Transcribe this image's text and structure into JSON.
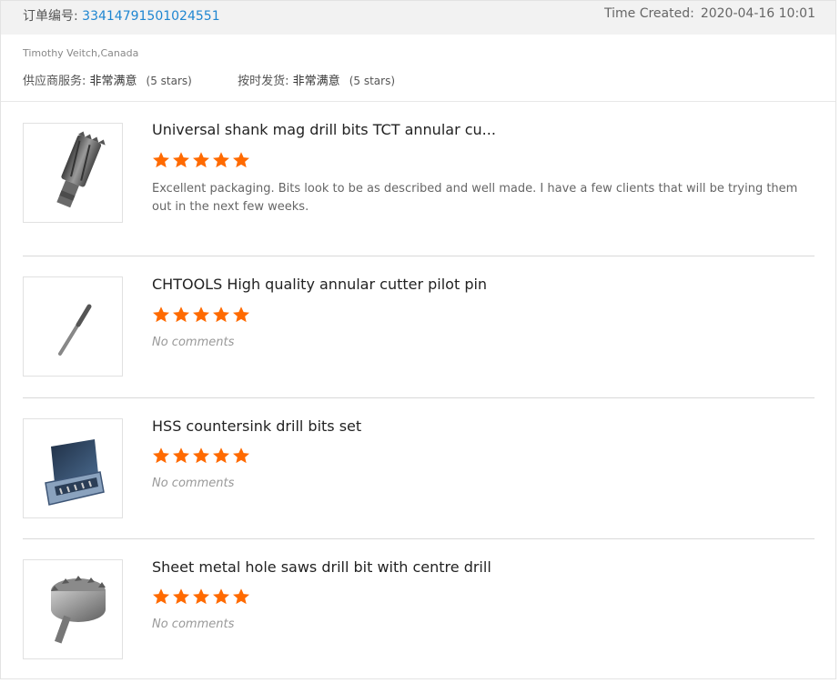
{
  "order": {
    "number_label": "订单编号:",
    "number": "33414791501024551",
    "time_label": "Time Created:",
    "time": "2020-04-16 10:01"
  },
  "buyer": {
    "name": "Timothy Veitch,Canada"
  },
  "seller_ratings": {
    "service_label": "供应商服务:",
    "service_value": "非常满意",
    "service_stars": "(5 stars)",
    "shipping_label": "按时发货:",
    "shipping_value": "非常满意",
    "shipping_stars": "(5 stars)"
  },
  "colors": {
    "star": "#ff6a00",
    "link": "#1f86d1"
  },
  "items": [
    {
      "title": "Universal shank mag drill bits TCT annular cu...",
      "rating": 5,
      "comment": "Excellent packaging. Bits look to be as described and well made. I have a few clients that will be trying them out in the next few weeks.",
      "image_icon": "annular-cutter-image"
    },
    {
      "title": "CHTOOLS High quality annular cutter pilot pin",
      "rating": 5,
      "comment": "No comments",
      "image_icon": "pilot-pin-image"
    },
    {
      "title": "HSS countersink drill bits set",
      "rating": 5,
      "comment": "No comments",
      "image_icon": "drill-bit-set-case-image"
    },
    {
      "title": "Sheet metal hole saws drill bit with centre drill",
      "rating": 5,
      "comment": "No comments",
      "image_icon": "hole-saw-image"
    }
  ]
}
